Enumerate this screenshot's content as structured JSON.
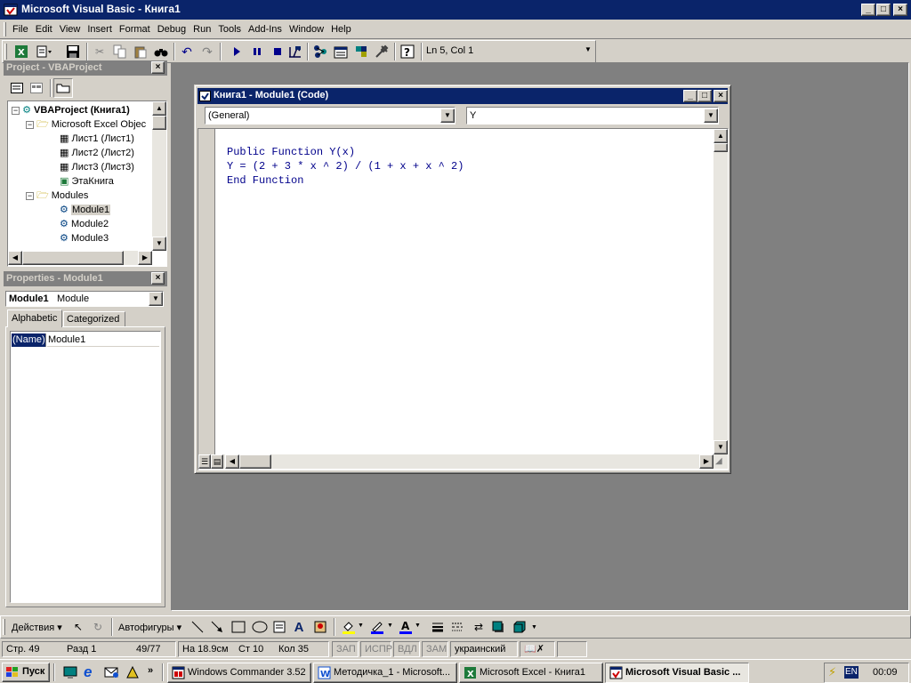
{
  "window": {
    "title": "Microsoft Visual Basic - Книга1"
  },
  "menu": [
    "File",
    "Edit",
    "View",
    "Insert",
    "Format",
    "Debug",
    "Run",
    "Tools",
    "Add-Ins",
    "Window",
    "Help"
  ],
  "toolbar": {
    "position": "Ln 5, Col 1"
  },
  "project": {
    "title": "Project - VBAProject",
    "root": "VBAProject (Книга1)",
    "excel_folder": "Microsoft Excel Objec",
    "sheets": [
      "Лист1 (Лист1)",
      "Лист2 (Лист2)",
      "Лист3 (Лист3)",
      "ЭтаКнига"
    ],
    "modules_folder": "Modules",
    "modules": [
      "Module1",
      "Module2",
      "Module3"
    ]
  },
  "properties": {
    "title": "Properties - Module1",
    "object_name": "Module1",
    "object_type": "Module",
    "tabs": [
      "Alphabetic",
      "Categorized"
    ],
    "row_name": "(Name)",
    "row_value": "Module1"
  },
  "code_window": {
    "title": "Книга1 - Module1 (Code)",
    "object_combo": "(General)",
    "proc_combo": "Y",
    "lines": [
      {
        "kw1": "Public Function",
        "text": " Y(x)",
        "kw2": ""
      },
      {
        "kw1": "",
        "text": "Y = (2 + 3 * x ^ 2) / (1 + x + x ^ 2)",
        "kw2": ""
      },
      {
        "kw1": "End Function",
        "text": "",
        "kw2": ""
      }
    ]
  },
  "drawing": {
    "actions": "Действия",
    "autoshapes": "Автофигуры"
  },
  "statusbar": {
    "page": "Стр.  49",
    "section": "Разд  1",
    "pages": "49/77",
    "at": "На 18.9см",
    "line": "Ст 10",
    "col": "Кол  35",
    "rec": "ЗАП",
    "trk": "ИСПР",
    "ext": "ВДЛ",
    "ovr": "ЗАМ",
    "lang": "украинский"
  },
  "taskbar": {
    "start": "Пуск",
    "buttons": [
      "Windows Commander 3.52",
      "Методичка_1 - Microsoft...",
      "Microsoft Excel - Книга1",
      "Microsoft Visual Basic ..."
    ],
    "lang": "EN",
    "clock": "00:09"
  },
  "colors": {
    "titlebar": "#0a246a",
    "mdi_bg": "#808080",
    "inactive_title": "#808080",
    "keyword": "#00008b"
  }
}
